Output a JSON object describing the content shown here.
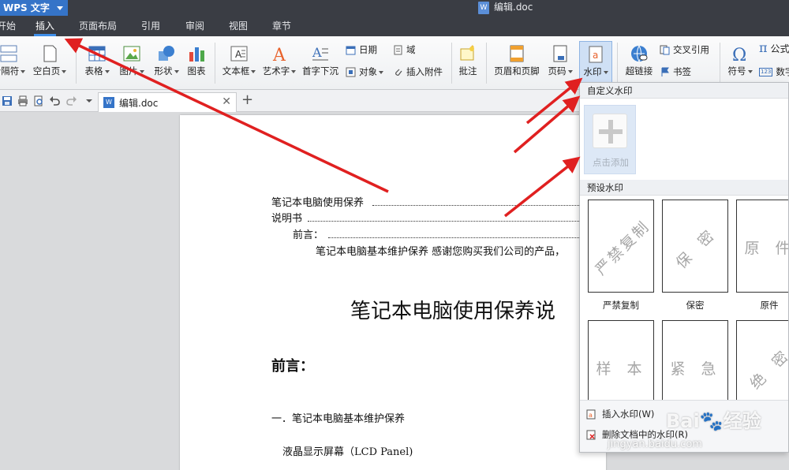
{
  "app": {
    "logo": "WPS 文字",
    "document_title": "编辑.doc"
  },
  "menu": {
    "tabs": [
      {
        "label": "开始"
      },
      {
        "label": "插入",
        "active": true
      },
      {
        "label": "页面布局"
      },
      {
        "label": "引用"
      },
      {
        "label": "审阅"
      },
      {
        "label": "视图"
      },
      {
        "label": "章节"
      }
    ]
  },
  "ribbon": {
    "fenyefu": "分隔符",
    "kongbaiye": "空白页",
    "biaoge": "表格",
    "tupian": "图片",
    "xingzhuang": "形状",
    "tubiao": "图表",
    "wenbenkuang": "文本框",
    "yishuzi": "艺术字",
    "shouzixiachen": "首字下沉",
    "riqi": "日期",
    "yu": "域",
    "duixiang": "对象",
    "charufujian": "插入附件",
    "pizhu": "批注",
    "yemeiheyejiao": "页眉和页脚",
    "yema": "页码",
    "shuiyin": "水印",
    "chaolianjie": "超链接",
    "jiaochayinyong": "交叉引用",
    "shuqian": "书签",
    "fuhao": "符号",
    "gongshi": "公式",
    "shuzi": "数字"
  },
  "doc_tabs": {
    "active_doc": "编辑.doc"
  },
  "document": {
    "toc": [
      {
        "text": "笔记本电脑使用保养"
      },
      {
        "text": "说明书"
      },
      {
        "text": "前言："
      },
      {
        "text": "笔记本电脑基本维护保养  感谢您购买我们公司的产品，"
      }
    ],
    "main_title": "笔记本电脑使用保养说",
    "preface_heading": "前言：",
    "section_1": "一．笔记本电脑基本维护保养",
    "lcd_line": "液晶显示屏幕（LCD Panel)"
  },
  "watermark_menu": {
    "custom_header": "自定义水印",
    "add_label": "点击添加",
    "preset_header": "预设水印",
    "presets": [
      {
        "watermark": "严禁复制",
        "label": "严禁复制"
      },
      {
        "watermark": "保 密",
        "label": "保密"
      },
      {
        "watermark": "原 件",
        "label": "原件"
      },
      {
        "watermark": "样 本"
      },
      {
        "watermark": "紧 急"
      },
      {
        "watermark": "绝 密"
      }
    ],
    "insert_action": "插入水印(W)",
    "delete_action": "删除文档中的水印(R)"
  },
  "overlay": {
    "brand": "Bai🐾经验",
    "url": "jingyan.baidu.com"
  },
  "colors": {
    "accent": "#3574c8",
    "annotation_arrow": "#e02020",
    "menu_bg": "#3a3d44"
  }
}
